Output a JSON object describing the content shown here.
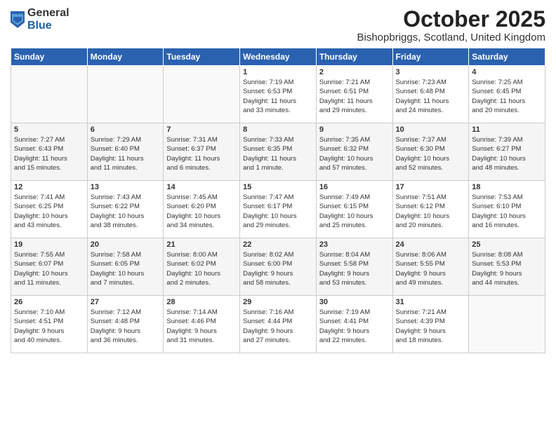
{
  "header": {
    "logo": {
      "general": "General",
      "blue": "Blue"
    },
    "title": "October 2025",
    "location": "Bishopbriggs, Scotland, United Kingdom"
  },
  "days_of_week": [
    "Sunday",
    "Monday",
    "Tuesday",
    "Wednesday",
    "Thursday",
    "Friday",
    "Saturday"
  ],
  "weeks": [
    [
      {
        "day": "",
        "content": ""
      },
      {
        "day": "",
        "content": ""
      },
      {
        "day": "",
        "content": ""
      },
      {
        "day": "1",
        "content": "Sunrise: 7:19 AM\nSunset: 6:53 PM\nDaylight: 11 hours\nand 33 minutes."
      },
      {
        "day": "2",
        "content": "Sunrise: 7:21 AM\nSunset: 6:51 PM\nDaylight: 11 hours\nand 29 minutes."
      },
      {
        "day": "3",
        "content": "Sunrise: 7:23 AM\nSunset: 6:48 PM\nDaylight: 11 hours\nand 24 minutes."
      },
      {
        "day": "4",
        "content": "Sunrise: 7:25 AM\nSunset: 6:45 PM\nDaylight: 11 hours\nand 20 minutes."
      }
    ],
    [
      {
        "day": "5",
        "content": "Sunrise: 7:27 AM\nSunset: 6:43 PM\nDaylight: 11 hours\nand 15 minutes."
      },
      {
        "day": "6",
        "content": "Sunrise: 7:29 AM\nSunset: 6:40 PM\nDaylight: 11 hours\nand 11 minutes."
      },
      {
        "day": "7",
        "content": "Sunrise: 7:31 AM\nSunset: 6:37 PM\nDaylight: 11 hours\nand 6 minutes."
      },
      {
        "day": "8",
        "content": "Sunrise: 7:33 AM\nSunset: 6:35 PM\nDaylight: 11 hours\nand 1 minute."
      },
      {
        "day": "9",
        "content": "Sunrise: 7:35 AM\nSunset: 6:32 PM\nDaylight: 10 hours\nand 57 minutes."
      },
      {
        "day": "10",
        "content": "Sunrise: 7:37 AM\nSunset: 6:30 PM\nDaylight: 10 hours\nand 52 minutes."
      },
      {
        "day": "11",
        "content": "Sunrise: 7:39 AM\nSunset: 6:27 PM\nDaylight: 10 hours\nand 48 minutes."
      }
    ],
    [
      {
        "day": "12",
        "content": "Sunrise: 7:41 AM\nSunset: 6:25 PM\nDaylight: 10 hours\nand 43 minutes."
      },
      {
        "day": "13",
        "content": "Sunrise: 7:43 AM\nSunset: 6:22 PM\nDaylight: 10 hours\nand 38 minutes."
      },
      {
        "day": "14",
        "content": "Sunrise: 7:45 AM\nSunset: 6:20 PM\nDaylight: 10 hours\nand 34 minutes."
      },
      {
        "day": "15",
        "content": "Sunrise: 7:47 AM\nSunset: 6:17 PM\nDaylight: 10 hours\nand 29 minutes."
      },
      {
        "day": "16",
        "content": "Sunrise: 7:49 AM\nSunset: 6:15 PM\nDaylight: 10 hours\nand 25 minutes."
      },
      {
        "day": "17",
        "content": "Sunrise: 7:51 AM\nSunset: 6:12 PM\nDaylight: 10 hours\nand 20 minutes."
      },
      {
        "day": "18",
        "content": "Sunrise: 7:53 AM\nSunset: 6:10 PM\nDaylight: 10 hours\nand 16 minutes."
      }
    ],
    [
      {
        "day": "19",
        "content": "Sunrise: 7:55 AM\nSunset: 6:07 PM\nDaylight: 10 hours\nand 11 minutes."
      },
      {
        "day": "20",
        "content": "Sunrise: 7:58 AM\nSunset: 6:05 PM\nDaylight: 10 hours\nand 7 minutes."
      },
      {
        "day": "21",
        "content": "Sunrise: 8:00 AM\nSunset: 6:02 PM\nDaylight: 10 hours\nand 2 minutes."
      },
      {
        "day": "22",
        "content": "Sunrise: 8:02 AM\nSunset: 6:00 PM\nDaylight: 9 hours\nand 58 minutes."
      },
      {
        "day": "23",
        "content": "Sunrise: 8:04 AM\nSunset: 5:58 PM\nDaylight: 9 hours\nand 53 minutes."
      },
      {
        "day": "24",
        "content": "Sunrise: 8:06 AM\nSunset: 5:55 PM\nDaylight: 9 hours\nand 49 minutes."
      },
      {
        "day": "25",
        "content": "Sunrise: 8:08 AM\nSunset: 5:53 PM\nDaylight: 9 hours\nand 44 minutes."
      }
    ],
    [
      {
        "day": "26",
        "content": "Sunrise: 7:10 AM\nSunset: 4:51 PM\nDaylight: 9 hours\nand 40 minutes."
      },
      {
        "day": "27",
        "content": "Sunrise: 7:12 AM\nSunset: 4:48 PM\nDaylight: 9 hours\nand 36 minutes."
      },
      {
        "day": "28",
        "content": "Sunrise: 7:14 AM\nSunset: 4:46 PM\nDaylight: 9 hours\nand 31 minutes."
      },
      {
        "day": "29",
        "content": "Sunrise: 7:16 AM\nSunset: 4:44 PM\nDaylight: 9 hours\nand 27 minutes."
      },
      {
        "day": "30",
        "content": "Sunrise: 7:19 AM\nSunset: 4:41 PM\nDaylight: 9 hours\nand 22 minutes."
      },
      {
        "day": "31",
        "content": "Sunrise: 7:21 AM\nSunset: 4:39 PM\nDaylight: 9 hours\nand 18 minutes."
      },
      {
        "day": "",
        "content": ""
      }
    ]
  ]
}
